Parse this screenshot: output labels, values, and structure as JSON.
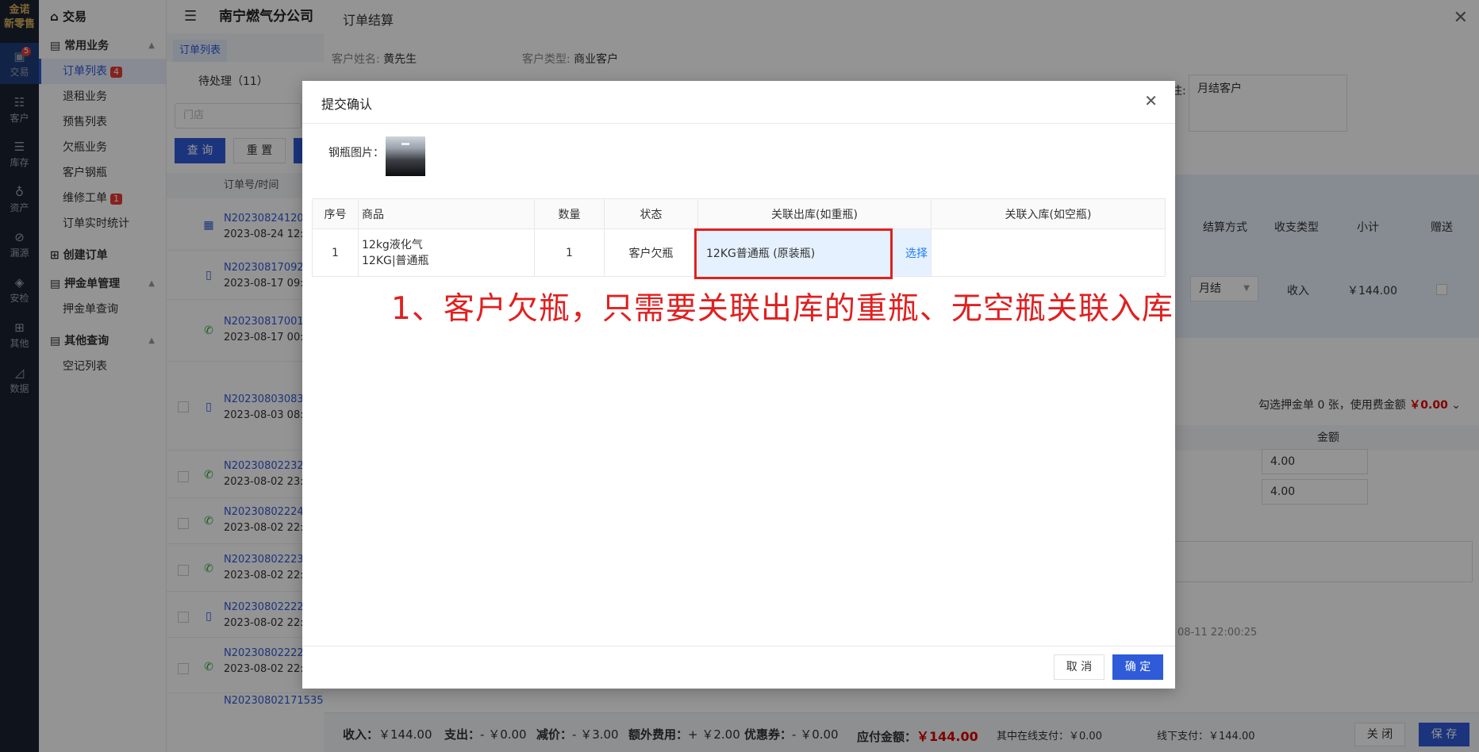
{
  "rail": {
    "logo_line1": "金诺",
    "logo_line2": "新零售",
    "items": [
      {
        "label": "交易",
        "badge": "5"
      },
      {
        "label": "客户"
      },
      {
        "label": "库存"
      },
      {
        "label": "资产"
      },
      {
        "label": "漏源"
      },
      {
        "label": "安检"
      },
      {
        "label": "其他"
      },
      {
        "label": "数据"
      }
    ]
  },
  "sidebar": {
    "head": "交易",
    "groups": [
      {
        "label": "常用业务",
        "items": [
          {
            "label": "订单列表",
            "badge": "4"
          },
          {
            "label": "退租业务"
          },
          {
            "label": "预售列表"
          },
          {
            "label": "欠瓶业务"
          },
          {
            "label": "客户钢瓶"
          },
          {
            "label": "维修工单",
            "badge": "1"
          },
          {
            "label": "订单实时统计"
          }
        ]
      },
      {
        "label": "创建订单",
        "items": []
      },
      {
        "label": "押金单管理",
        "items": [
          {
            "label": "押金单查询"
          }
        ]
      },
      {
        "label": "其他查询",
        "items": [
          {
            "label": "空记列表"
          }
        ]
      }
    ]
  },
  "listcol": {
    "company": "南宁燃气分公司",
    "tab": "订单列表",
    "pending": "待处理（11）",
    "store_placeholder": "门店",
    "query_btn": "查 询",
    "reset_btn": "重 置",
    "col_header": "订单号/时间",
    "rows": [
      {
        "no": "N2023082412023",
        "time": "2023-08-24 12:0"
      },
      {
        "no": "N2023081709225",
        "time": "2023-08-17 09:2"
      },
      {
        "no": "N2023081700191",
        "time": "2023-08-17 00:1"
      },
      {
        "no": "N2023080308332",
        "time": "2023-08-03 08:3"
      },
      {
        "no": "N2023080223256",
        "time": "2023-08-02 23:2"
      },
      {
        "no": "N2023080222427",
        "time": "2023-08-02 22:4"
      },
      {
        "no": "N2023080222341",
        "time": "2023-08-02 22:3"
      },
      {
        "no": "N2023080222232",
        "time": "2023-08-02 22:2"
      },
      {
        "no": "N2023080222201",
        "time": "2023-08-02 22:2"
      },
      {
        "no": "N20230802171535"
      }
    ]
  },
  "panel": {
    "title": "订单结算",
    "customer_label": "客户姓名:",
    "customer_name": "黄先生",
    "type_label": "客户类型:",
    "type_value": "商业客户",
    "remark_label_tail": "注:",
    "remark_value": "月结客户",
    "headers": [
      "结算方式",
      "收支类型",
      "小计",
      "赠送"
    ],
    "settle_method": "月结",
    "income": "收入",
    "subtotal": "￥144.00",
    "deposit_text": "勾选押金单 0 张，使用费金额",
    "deposit_amount": "￥0.00",
    "amount_header": "金额",
    "amounts": [
      "4.00",
      "4.00"
    ],
    "timestamp": "08-11 22:00:25"
  },
  "footer": {
    "income_label": "收入：",
    "income_value": "￥144.00",
    "expense_label": "支出：",
    "expense_value": "- ￥0.00",
    "discount_label": "减价：",
    "discount_value": "- ￥3.00",
    "extra_label": "额外费用：",
    "extra_value": "+ ￥2.00",
    "coupon_label": "优惠券：",
    "coupon_value": "- ￥0.00",
    "due_label": "应付金额：",
    "due_value": "￥144.00",
    "online_label": "其中在线支付：",
    "online_value": "￥0.00",
    "offline_label": "线下支付：",
    "offline_value": "￥144.00",
    "close_btn": "关 闭",
    "save_btn": "保 存"
  },
  "modal": {
    "title": "提交确认",
    "photo_label": "钢瓶图片：",
    "columns": [
      "序号",
      "商品",
      "数量",
      "状态",
      "关联出库(如重瓶)",
      "关联入库(如空瓶)"
    ],
    "rows": [
      {
        "index": "1",
        "goods_line1": "12kg液化气",
        "goods_line2": "12KG|普通瓶",
        "qty": "1",
        "status": "客户欠瓶",
        "out_link": "12KG普通瓶 (原装瓶)",
        "select": "选择",
        "in_link": ""
      }
    ],
    "annotation": "1、客户欠瓶，只需要关联出库的重瓶、无空瓶关联入库",
    "cancel_btn": "取 消",
    "ok_btn": "确 定"
  },
  "colors": {
    "primary": "#2f5bd8",
    "danger": "#e02020",
    "rail_bg": "#1b2231"
  }
}
